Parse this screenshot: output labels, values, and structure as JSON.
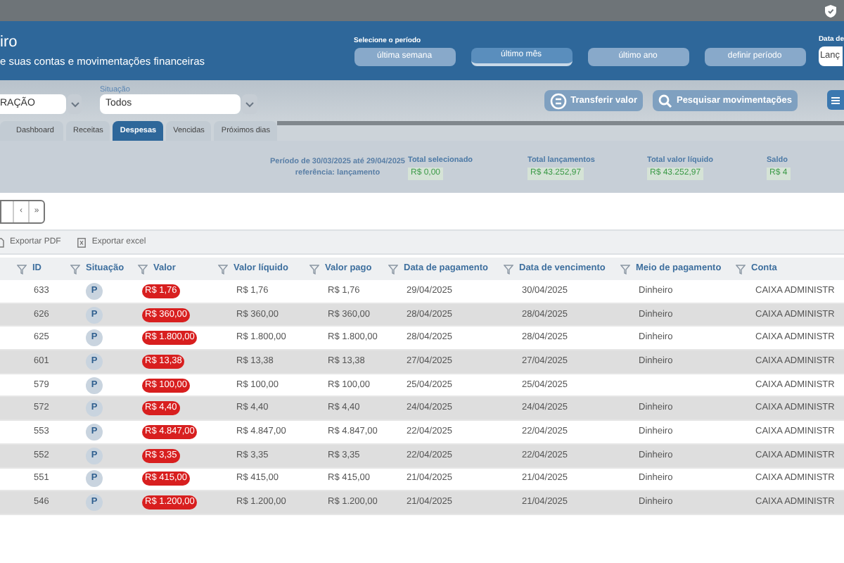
{
  "header": {
    "title": "iro",
    "subtitle": "e suas contas e movimentações financeiras",
    "period": {
      "label": "Selecione o período",
      "options": [
        {
          "label": "última semana",
          "selected": false
        },
        {
          "label": "último mês",
          "selected": true
        },
        {
          "label": "último ano",
          "selected": false
        },
        {
          "label": "definir período",
          "selected": false
        }
      ]
    },
    "date_field": {
      "label": "Data de",
      "value": "Lanç"
    }
  },
  "filters": {
    "account": {
      "value": "RAÇÃO"
    },
    "status": {
      "label": "Situação",
      "value": "Todos"
    }
  },
  "actions": [
    {
      "kind": "transfer",
      "label": "Transferir valor"
    },
    {
      "kind": "search",
      "label": "Pesquisar movimentações"
    },
    {
      "kind": "menu"
    }
  ],
  "tabs": [
    {
      "label": "Dashboard",
      "selected": false
    },
    {
      "label": "Receitas",
      "selected": false
    },
    {
      "label": "Despesas",
      "selected": true
    },
    {
      "label": "Vencidas",
      "selected": false
    },
    {
      "label": "Próximos dias",
      "selected": false
    }
  ],
  "summary": {
    "period_lines": [
      "Período de 30/03/2025 até 29/04/2025",
      "referência: lançamento"
    ],
    "totals": [
      {
        "label": "Total selecionado",
        "value": "R$ 0,00"
      },
      {
        "label": "Total lançamentos",
        "value": "R$ 43.252,97"
      },
      {
        "label": "Total valor líquido",
        "value": "R$ 43.252,97"
      },
      {
        "label": "Saldo",
        "value": "R$ 4"
      }
    ]
  },
  "pagination": [
    "‹",
    "»"
  ],
  "exports": [
    {
      "kind": "pdf",
      "label": "Exportar PDF"
    },
    {
      "kind": "excel",
      "label": "Exportar excel"
    }
  ],
  "table": {
    "columns": [
      "ID",
      "Situação",
      "Valor",
      "Valor líquido",
      "Valor pago",
      "Data de pagamento",
      "Data de vencimento",
      "Meio de pagamento",
      "Conta"
    ],
    "rows": [
      {
        "id": "633",
        "status": "P",
        "value": "R$ 1,76",
        "net": "R$ 1,76",
        "paid": "R$ 1,76",
        "paid_date": "29/04/2025",
        "due_date": "30/04/2025",
        "method": "Dinheiro",
        "account": "CAIXA ADMINISTR"
      },
      {
        "id": "626",
        "status": "P",
        "value": "R$ 360,00",
        "net": "R$ 360,00",
        "paid": "R$ 360,00",
        "paid_date": "28/04/2025",
        "due_date": "28/04/2025",
        "method": "Dinheiro",
        "account": "CAIXA ADMINISTR"
      },
      {
        "id": "625",
        "status": "P",
        "value": "R$ 1.800,00",
        "net": "R$ 1.800,00",
        "paid": "R$ 1.800,00",
        "paid_date": "28/04/2025",
        "due_date": "28/04/2025",
        "method": "Dinheiro",
        "account": "CAIXA ADMINISTR"
      },
      {
        "id": "601",
        "status": "P",
        "value": "R$ 13,38",
        "net": "R$ 13,38",
        "paid": "R$ 13,38",
        "paid_date": "27/04/2025",
        "due_date": "27/04/2025",
        "method": "Dinheiro",
        "account": "CAIXA ADMINISTR"
      },
      {
        "id": "579",
        "status": "P",
        "value": "R$ 100,00",
        "net": "R$ 100,00",
        "paid": "R$ 100,00",
        "paid_date": "25/04/2025",
        "due_date": "25/04/2025",
        "account": "CAIXA ADMINISTR"
      },
      {
        "id": "572",
        "status": "P",
        "value": "R$ 4,40",
        "net": "R$ 4,40",
        "paid": "R$ 4,40",
        "paid_date": "24/04/2025",
        "due_date": "24/04/2025",
        "method": "Dinheiro",
        "account": "CAIXA ADMINISTR"
      },
      {
        "id": "553",
        "status": "P",
        "value": "R$ 4.847,00",
        "net": "R$ 4.847,00",
        "paid": "R$ 4.847,00",
        "paid_date": "22/04/2025",
        "due_date": "22/04/2025",
        "method": "Dinheiro",
        "account": "CAIXA ADMINISTR"
      },
      {
        "id": "552",
        "status": "P",
        "value": "R$ 3,35",
        "net": "R$ 3,35",
        "paid": "R$ 3,35",
        "paid_date": "22/04/2025",
        "due_date": "22/04/2025",
        "method": "Dinheiro",
        "account": "CAIXA ADMINISTR"
      },
      {
        "id": "551",
        "status": "P",
        "value": "R$ 415,00",
        "net": "R$ 415,00",
        "paid": "R$ 415,00",
        "paid_date": "21/04/2025",
        "due_date": "21/04/2025",
        "method": "Dinheiro",
        "account": "CAIXA ADMINISTR"
      },
      {
        "id": "546",
        "status": "P",
        "value": "R$ 1.200,00",
        "net": "R$ 1.200,00",
        "paid": "R$ 1.200,00",
        "paid_date": "21/04/2025",
        "due_date": "21/04/2025",
        "method": "Dinheiro",
        "account": "CAIXA ADMINISTR"
      }
    ]
  }
}
